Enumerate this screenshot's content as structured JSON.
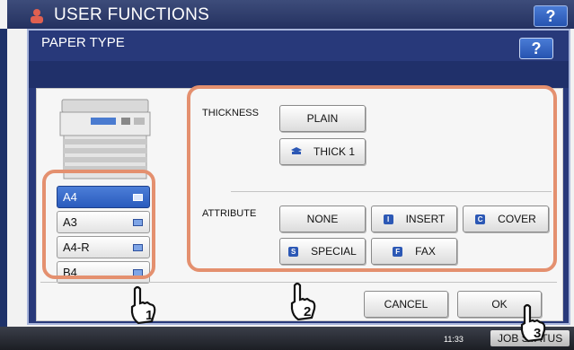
{
  "background_window": {
    "title": "USER FUNCTIONS",
    "help_label": "?",
    "clock": "11:33",
    "job_status_label": "JOB STATUS"
  },
  "dialog": {
    "title": "PAPER TYPE",
    "help_label": "?"
  },
  "trays": [
    {
      "label": "A4",
      "selected": true
    },
    {
      "label": "A3",
      "selected": false
    },
    {
      "label": "A4-R",
      "selected": false
    },
    {
      "label": "B4",
      "selected": false
    }
  ],
  "thickness": {
    "label": "THICKNESS",
    "options": [
      "PLAIN",
      "THICK 1"
    ]
  },
  "attribute": {
    "label": "ATTRIBUTE",
    "options": [
      "NONE",
      "INSERT",
      "COVER",
      "SPECIAL",
      "FAX"
    ]
  },
  "footer": {
    "cancel_label": "CANCEL",
    "ok_label": "OK"
  },
  "callouts": [
    "1",
    "2",
    "3"
  ],
  "colors": {
    "accent_blue": "#2a5bbd",
    "highlight": "#e4906f",
    "dialog_frame": "#28397a"
  }
}
